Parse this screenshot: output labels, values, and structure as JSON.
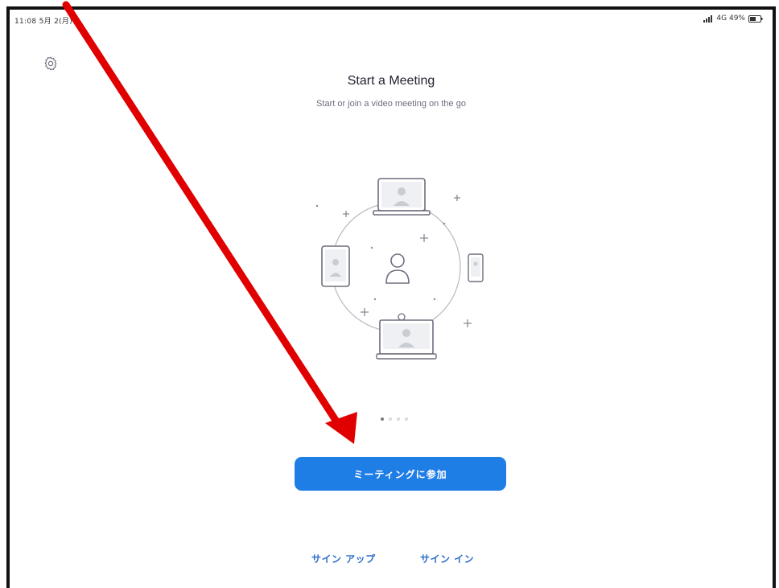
{
  "status_bar": {
    "time": "11:08 5月 2(月)",
    "network": "4G 49%"
  },
  "header": {
    "title": "Start a Meeting",
    "subtitle": "Start or join a video meeting on the go"
  },
  "carousel": {
    "page_count": 4,
    "active_index": 0
  },
  "actions": {
    "join_label": "ミーティングに参加",
    "signup_label": "サイン アップ",
    "signin_label": "サイン イン"
  },
  "icons": {
    "settings": "gear-icon",
    "illustration": "meeting-devices-illustration",
    "annotation": "red-arrow-annotation"
  },
  "colors": {
    "accent": "#1f7de6",
    "link": "#2d6ec9",
    "annotation": "#e00000",
    "title": "#232333"
  }
}
